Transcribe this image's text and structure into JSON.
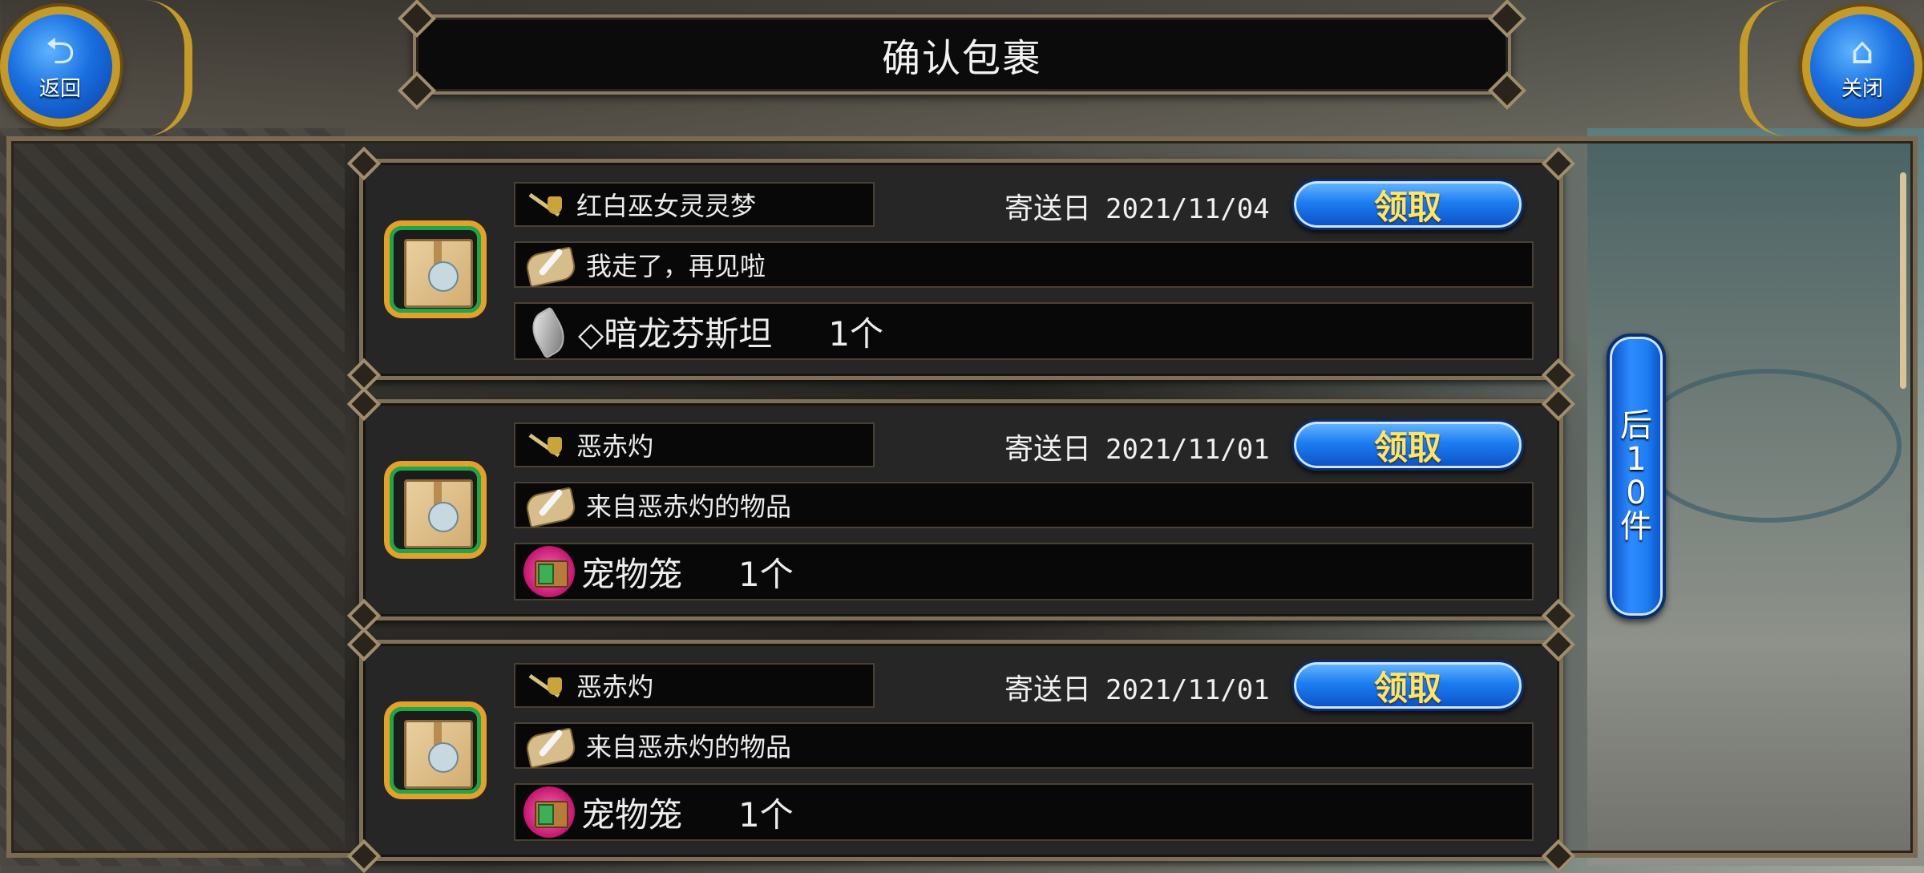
{
  "header": {
    "title": "确认包裹",
    "back_label": "返回",
    "close_label": "关闭"
  },
  "parcels": [
    {
      "sender": "红白巫女灵灵梦",
      "date_prefix": "寄送日",
      "date": "2021/11/04",
      "claim_label": "领取",
      "message": "我走了，再见啦",
      "item_name": "◇暗龙芬斯坦",
      "item_qty": "1个",
      "item_icon": "crystal-icon"
    },
    {
      "sender": "恶赤灼",
      "date_prefix": "寄送日",
      "date": "2021/11/01",
      "claim_label": "领取",
      "message": "来自恶赤灼的物品",
      "item_name": "宠物笼",
      "item_qty": "1个",
      "item_icon": "pet-cage-icon"
    },
    {
      "sender": "恶赤灼",
      "date_prefix": "寄送日",
      "date": "2021/11/01",
      "claim_label": "领取",
      "message": "来自恶赤灼的物品",
      "item_name": "宠物笼",
      "item_qty": "1个",
      "item_icon": "pet-cage-icon"
    }
  ],
  "pagination": {
    "next_label": "后10件"
  },
  "colors": {
    "button_blue": "#1d7ef2",
    "claim_text": "#ffe566",
    "frame_gold": "#c49a2a"
  }
}
